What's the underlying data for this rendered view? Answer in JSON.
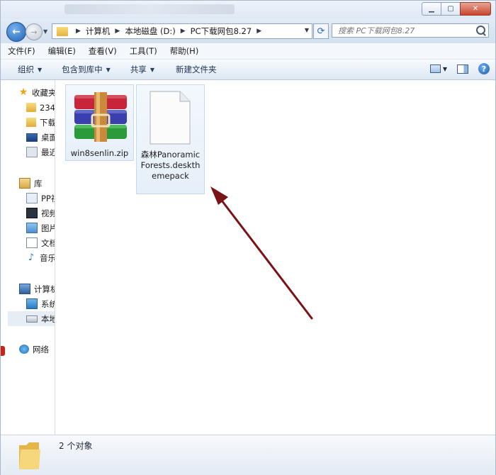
{
  "window": {
    "minimize_icon": "minimize-icon",
    "maximize_icon": "maximize-icon",
    "close_icon": "close-icon"
  },
  "address": {
    "crumbs": [
      "计算机",
      "本地磁盘 (D:)",
      "PC下载网包8.27"
    ]
  },
  "search": {
    "placeholder": "搜索 PC下载网包8.27"
  },
  "menu": [
    "文件(F)",
    "编辑(E)",
    "查看(V)",
    "工具(T)",
    "帮助(H)"
  ],
  "toolbar": {
    "organize": "组织",
    "include_library": "包含到库中",
    "share": "共享",
    "new_folder": "新建文件夹"
  },
  "nav": {
    "favorites": "收藏夹",
    "fav_items": [
      "234",
      "下载",
      "桌面",
      "最近"
    ],
    "libraries": "库",
    "lib_items": [
      "PP视",
      "视频",
      "图片",
      "文档",
      "音乐"
    ],
    "computer": "计算机",
    "computer_items": [
      "系统",
      "本地"
    ],
    "network": "网络"
  },
  "files": [
    {
      "name": "win8senlin.zip",
      "icon": "winrar-archive-icon"
    },
    {
      "name": "森林PanoramicForests.deskthemepack",
      "icon": "blank-document-icon"
    }
  ],
  "status": {
    "count": "2 个对象"
  },
  "colors": {
    "accent": "#2a6bc3",
    "arrow": "#7a1216",
    "selection": "#e6eff9"
  }
}
